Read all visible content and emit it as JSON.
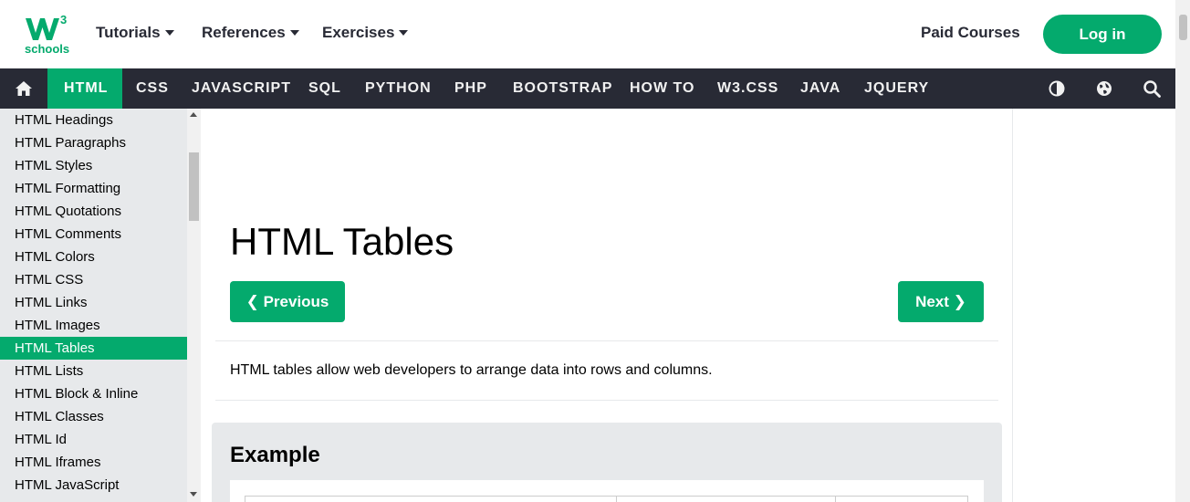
{
  "header": {
    "logo_text": "schools",
    "logo_superscript": "3",
    "menus": [
      {
        "label": "Tutorials"
      },
      {
        "label": "References"
      },
      {
        "label": "Exercises"
      }
    ],
    "paid_courses": "Paid Courses",
    "login": "Log in"
  },
  "nav": {
    "home_icon": "home-icon",
    "items": [
      "HTML",
      "CSS",
      "JAVASCRIPT",
      "SQL",
      "PYTHON",
      "PHP",
      "BOOTSTRAP",
      "HOW TO",
      "W3.CSS",
      "JAVA",
      "JQUERY"
    ],
    "active": "HTML",
    "tools": [
      "contrast-icon",
      "globe-icon",
      "search-icon"
    ]
  },
  "sidebar": {
    "items": [
      "HTML Headings",
      "HTML Paragraphs",
      "HTML Styles",
      "HTML Formatting",
      "HTML Quotations",
      "HTML Comments",
      "HTML Colors",
      "HTML CSS",
      "HTML Links",
      "HTML Images",
      "HTML Tables",
      "HTML Lists",
      "HTML Block & Inline",
      "HTML Classes",
      "HTML Id",
      "HTML Iframes",
      "HTML JavaScript"
    ],
    "active": "HTML Tables"
  },
  "main": {
    "title": "HTML Tables",
    "previous": "❮ Previous",
    "next": "Next ❯",
    "intro": "HTML tables allow web developers to arrange data into rows and columns.",
    "example_title": "Example"
  },
  "colors": {
    "accent": "#04aa6d",
    "navbar": "#282a35",
    "sidebar": "#e7e9eb"
  }
}
